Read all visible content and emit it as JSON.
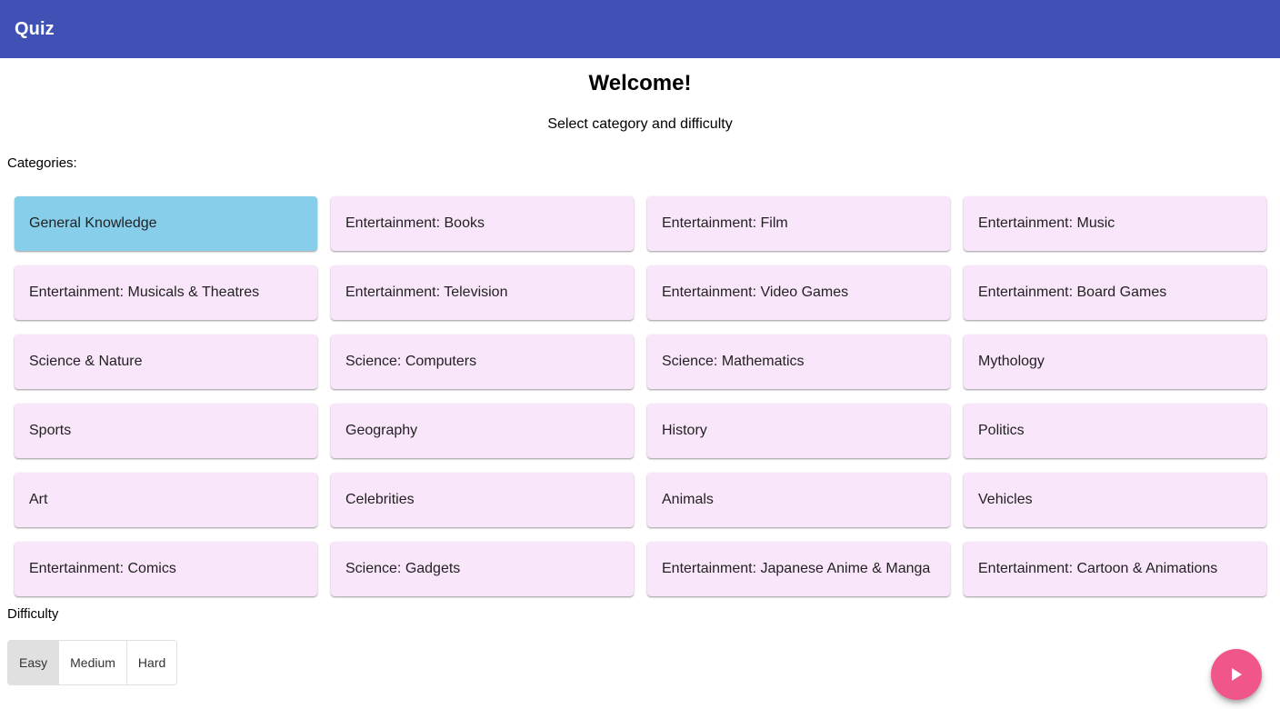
{
  "app_bar": {
    "title": "Quiz"
  },
  "main": {
    "welcome": "Welcome!",
    "subtitle": "Select category and difficulty",
    "categories_label": "Categories:",
    "difficulty_label": "Difficulty"
  },
  "categories": [
    {
      "label": "General Knowledge",
      "selected": true
    },
    {
      "label": "Entertainment: Books",
      "selected": false
    },
    {
      "label": "Entertainment: Film",
      "selected": false
    },
    {
      "label": "Entertainment: Music",
      "selected": false
    },
    {
      "label": "Entertainment: Musicals & Theatres",
      "selected": false
    },
    {
      "label": "Entertainment: Television",
      "selected": false
    },
    {
      "label": "Entertainment: Video Games",
      "selected": false
    },
    {
      "label": "Entertainment: Board Games",
      "selected": false
    },
    {
      "label": "Science & Nature",
      "selected": false
    },
    {
      "label": "Science: Computers",
      "selected": false
    },
    {
      "label": "Science: Mathematics",
      "selected": false
    },
    {
      "label": "Mythology",
      "selected": false
    },
    {
      "label": "Sports",
      "selected": false
    },
    {
      "label": "Geography",
      "selected": false
    },
    {
      "label": "History",
      "selected": false
    },
    {
      "label": "Politics",
      "selected": false
    },
    {
      "label": "Art",
      "selected": false
    },
    {
      "label": "Celebrities",
      "selected": false
    },
    {
      "label": "Animals",
      "selected": false
    },
    {
      "label": "Vehicles",
      "selected": false
    },
    {
      "label": "Entertainment: Comics",
      "selected": false
    },
    {
      "label": "Science: Gadgets",
      "selected": false
    },
    {
      "label": "Entertainment: Japanese Anime & Manga",
      "selected": false
    },
    {
      "label": "Entertainment: Cartoon & Animations",
      "selected": false
    }
  ],
  "difficulty": {
    "options": [
      {
        "label": "Easy",
        "selected": true
      },
      {
        "label": "Medium",
        "selected": false
      },
      {
        "label": "Hard",
        "selected": false
      }
    ]
  },
  "fab": {
    "icon": "play-icon"
  },
  "colors": {
    "app_bar": "#3f51b5",
    "card_default": "#fae6fa",
    "card_selected": "#87ceeb",
    "difficulty_selected": "#e0e0e0",
    "fab": "#f0568a"
  }
}
